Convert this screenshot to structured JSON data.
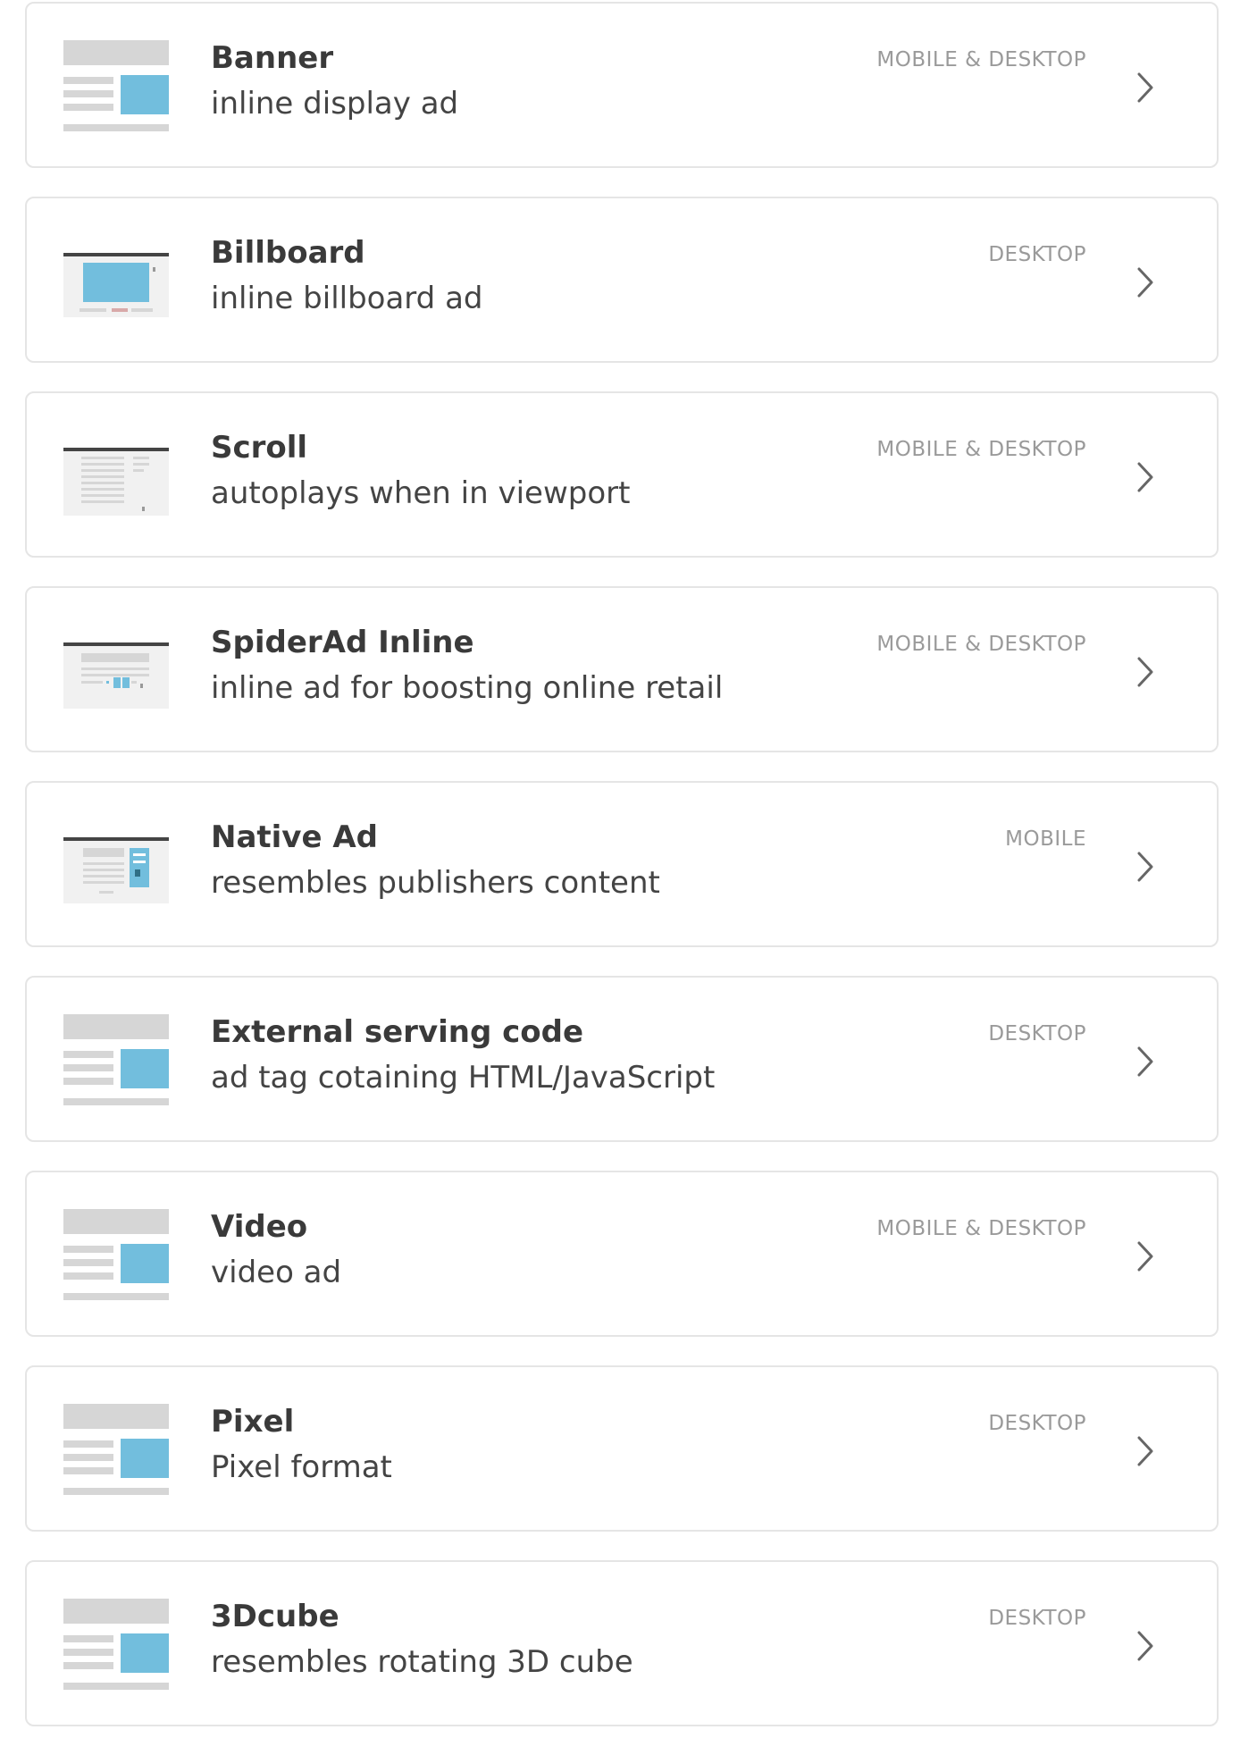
{
  "items": [
    {
      "title": "Banner",
      "subtitle": "inline display ad",
      "platform": "MOBILE & DESKTOP",
      "thumb": "banner-thumbnail-icon"
    },
    {
      "title": "Billboard",
      "subtitle": "inline billboard ad",
      "platform": "DESKTOP",
      "thumb": "billboard-thumbnail-icon"
    },
    {
      "title": "Scroll",
      "subtitle": "autoplays when in viewport",
      "platform": "MOBILE & DESKTOP",
      "thumb": "scroll-thumbnail-icon"
    },
    {
      "title": "SpiderAd Inline",
      "subtitle": "inline ad for boosting online retail",
      "platform": "MOBILE & DESKTOP",
      "thumb": "spiderad-thumbnail-icon"
    },
    {
      "title": "Native Ad",
      "subtitle": "resembles publishers content",
      "platform": "MOBILE",
      "thumb": "native-ad-thumbnail-icon"
    },
    {
      "title": "External serving code",
      "subtitle": "ad tag cotaining HTML/JavaScript",
      "platform": "DESKTOP",
      "thumb": "banner-thumbnail-icon"
    },
    {
      "title": "Video",
      "subtitle": "video ad",
      "platform": "MOBILE & DESKTOP",
      "thumb": "banner-thumbnail-icon"
    },
    {
      "title": "Pixel",
      "subtitle": "Pixel format",
      "platform": "DESKTOP",
      "thumb": "banner-thumbnail-icon"
    },
    {
      "title": "3Dcube",
      "subtitle": "resembles rotating 3D cube",
      "platform": "DESKTOP",
      "thumb": "banner-thumbnail-icon"
    }
  ],
  "colors": {
    "accent": "#72bedd",
    "placeholder": "#d6d6d6",
    "bar": "#444444"
  },
  "icons": {
    "chevron": "chevron-right-icon"
  }
}
